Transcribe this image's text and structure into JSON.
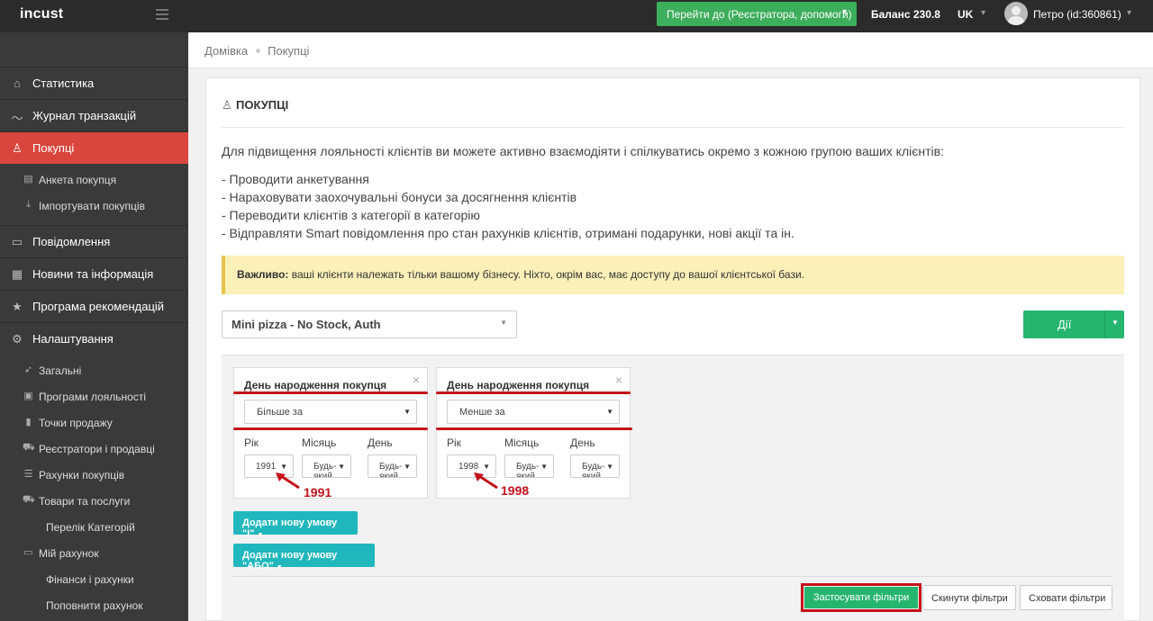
{
  "topbar": {
    "logo": "incust",
    "goto_label": "Перейти до (Реєстратора, допомоги)",
    "balance_label": "Баланс 230.8",
    "lang": "UK",
    "user_name": "Петро (id:360861)"
  },
  "sidebar": {
    "items": [
      {
        "label": "Статистика",
        "icon": "home-icon"
      },
      {
        "label": "Журнал транзакцій",
        "icon": "chart-line-icon"
      },
      {
        "label": "Покупці",
        "icon": "users-icon"
      },
      {
        "label": "Повідомлення",
        "icon": "message-icon"
      },
      {
        "label": "Новини та інформація",
        "icon": "newspaper-icon"
      },
      {
        "label": "Програма рекомендацій",
        "icon": "star-icon"
      },
      {
        "label": "Налаштування",
        "icon": "gear-icon"
      }
    ],
    "customers_sub": [
      {
        "label": "Анкета покупця",
        "icon": "document-icon"
      },
      {
        "label": "Імпортувати покупців",
        "icon": "download-icon"
      }
    ],
    "settings_sub": [
      {
        "label": "Загальні",
        "icon": "rocket-icon"
      },
      {
        "label": "Програми лояльності",
        "icon": "gift-icon"
      },
      {
        "label": "Точки продажу",
        "icon": "building-icon"
      },
      {
        "label": "Реєстратори і продавці",
        "icon": "cart-icon"
      },
      {
        "label": "Рахунки покупців",
        "icon": "list-icon"
      },
      {
        "label": "Товари та послуги",
        "icon": "cart-icon"
      },
      {
        "label": "Перелік Категорій",
        "icon": ""
      },
      {
        "label": "Мій рахунок",
        "icon": "money-icon"
      },
      {
        "label": "Фінанси і рахунки",
        "icon": ""
      },
      {
        "label": "Поповнити рахунок",
        "icon": ""
      }
    ],
    "active_color": "#d9463d"
  },
  "breadcrumb": {
    "home": "Домівка",
    "current": "Покупці"
  },
  "page": {
    "title": "ПОКУПЦІ",
    "intro": "Для підвищення лояльності клієнтів ви можете активно взаємодіяти і спілкуватись окремо з кожною групою ваших клієнтів:",
    "bullets": [
      "- Проводити анкетування",
      "- Нараховувати заохочувальні бонуси за досягнення клієнтів",
      "- Переводити клієнтів з категорії в категорію",
      "- Відправляти Smart повідомлення про стан рахунків клієнтів, отримані подарунки, нові акції та ін."
    ],
    "alert_strong": "Важливо:",
    "alert_text": " ваші клієнти належать тільки вашому бізнесу. Ніхто, окрім вас, має доступу до вашої клієнтської бази.",
    "program_select": "Mini pizza - No Stock, Auth",
    "actions_label": "Дії"
  },
  "filters": {
    "conditions": [
      {
        "title": "День народження покупця",
        "operator": "Більше за",
        "year_label": "Рік",
        "month_label": "Місяць",
        "day_label": "День",
        "year": "1991",
        "month": "Будь-який",
        "day": "Будь-який",
        "annotation": "1991"
      },
      {
        "title": "День народження покупця",
        "operator": "Менше за",
        "year_label": "Рік",
        "month_label": "Місяць",
        "day_label": "День",
        "year": "1998",
        "month": "Будь-який",
        "day": "Будь-який",
        "annotation": "1998"
      }
    ],
    "add_and": "Додати нову умову \"І\"",
    "add_or": "Додати нову умову \"АБО\"",
    "apply": "Застосувати фільтри",
    "reset": "Скинути фільтри",
    "hide": "Сховати фільтри",
    "annotation_color": "#c4121b"
  }
}
